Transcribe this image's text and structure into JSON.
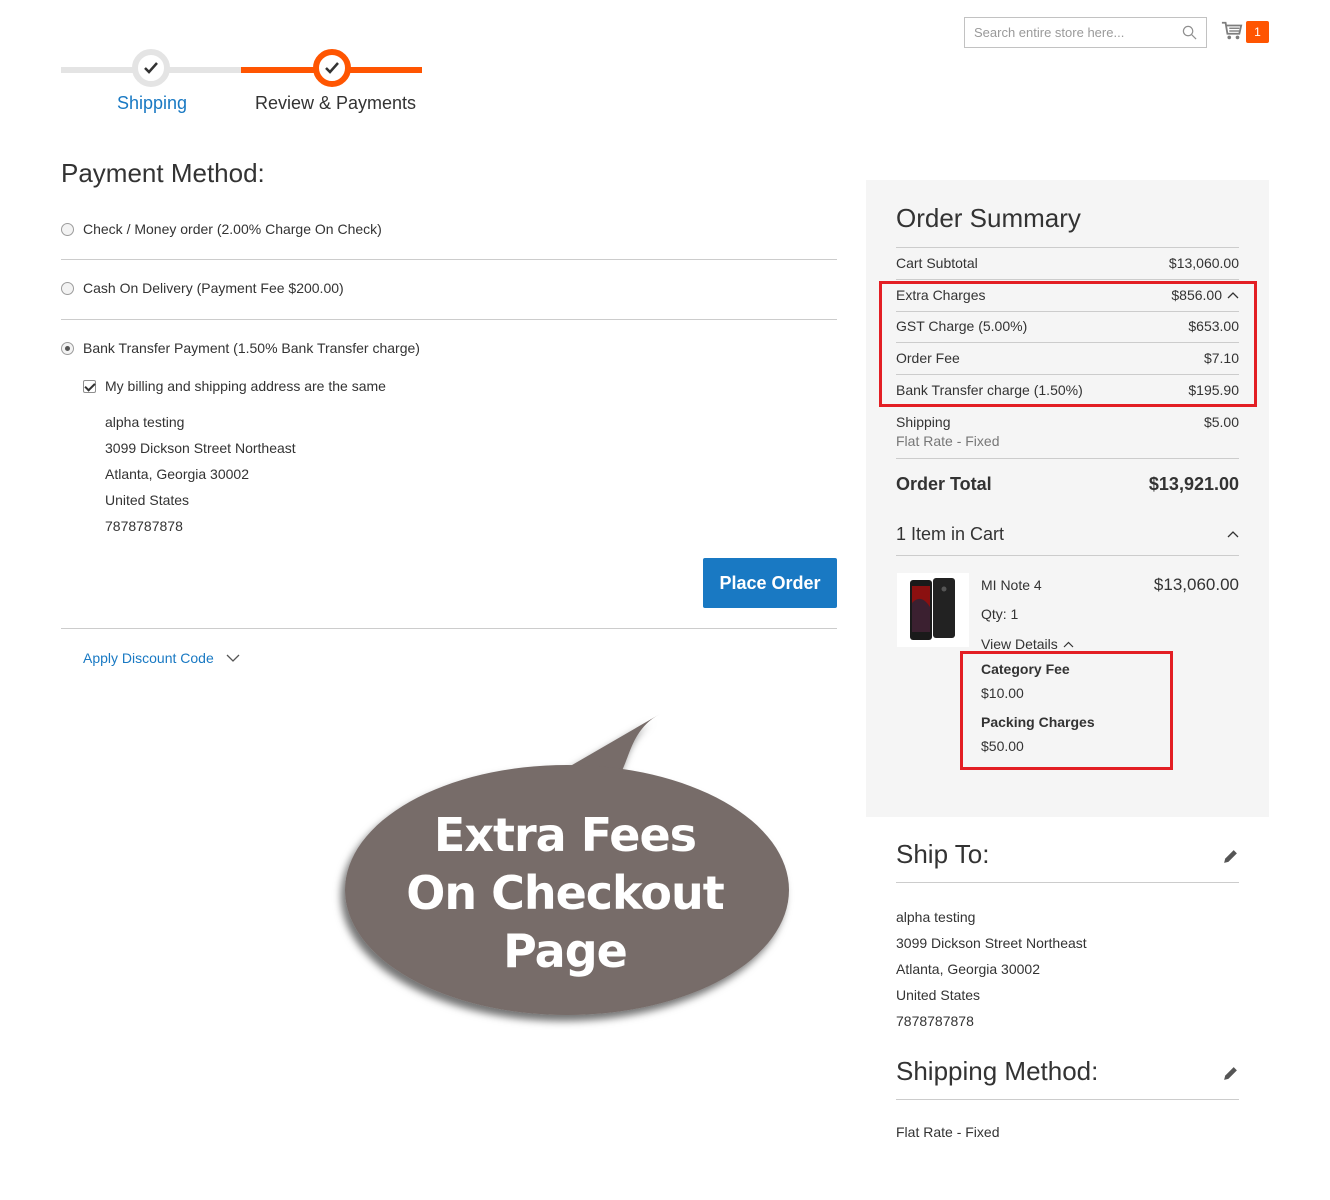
{
  "header": {
    "search_placeholder": "Search entire store here...",
    "cart_count": "1"
  },
  "progress": {
    "steps": [
      {
        "label": "Shipping",
        "state": "complete"
      },
      {
        "label": "Review & Payments",
        "state": "active"
      }
    ]
  },
  "payment": {
    "title": "Payment Method:",
    "options": [
      {
        "label": "Check / Money order (2.00% Charge On Check)",
        "selected": false
      },
      {
        "label": "Cash On Delivery (Payment Fee $200.00)",
        "selected": false
      },
      {
        "label": "Bank Transfer Payment (1.50% Bank Transfer charge)",
        "selected": true
      }
    ],
    "same_address_label": "My billing and shipping address are the same",
    "address": [
      "alpha testing",
      "3099 Dickson Street Northeast",
      "Atlanta, Georgia 30002",
      "United States",
      "7878787878"
    ],
    "place_order_label": "Place Order",
    "discount_label": "Apply Discount Code"
  },
  "callout": {
    "lines": [
      "Extra Fees",
      "On Checkout",
      "Page"
    ]
  },
  "summary": {
    "title": "Order Summary",
    "cart_subtotal_label": "Cart Subtotal",
    "cart_subtotal_value": "$13,060.00",
    "extra_charges_label": "Extra Charges",
    "extra_charges_value": "$856.00",
    "gst_label": "GST Charge (5.00%)",
    "gst_value": "$653.00",
    "order_fee_label": "Order Fee",
    "order_fee_value": "$7.10",
    "bank_label": "Bank Transfer charge (1.50%)",
    "bank_value": "$195.90",
    "shipping_label": "Shipping",
    "shipping_value": "$5.00",
    "shipping_method": "Flat Rate - Fixed",
    "total_label": "Order Total",
    "total_value": "$13,921.00",
    "items_in_cart": "1 Item in Cart",
    "item": {
      "name": "MI Note 4",
      "price": "$13,060.00",
      "qty": "Qty: 1",
      "view_details": "View Details",
      "fees": [
        {
          "label": "Category Fee",
          "value": "$10.00"
        },
        {
          "label": "Packing Charges",
          "value": "$50.00"
        }
      ]
    }
  },
  "ship_to": {
    "title": "Ship To:",
    "address": [
      "alpha testing",
      "3099 Dickson Street Northeast",
      "Atlanta, Georgia 30002",
      "United States",
      "7878787878"
    ]
  },
  "shipping_method": {
    "title": "Shipping Method:",
    "value": "Flat Rate - Fixed"
  },
  "colors": {
    "accent": "#ff5501",
    "link": "#1979c3",
    "highlight": "#e31e24",
    "bubble": "#776c69"
  }
}
